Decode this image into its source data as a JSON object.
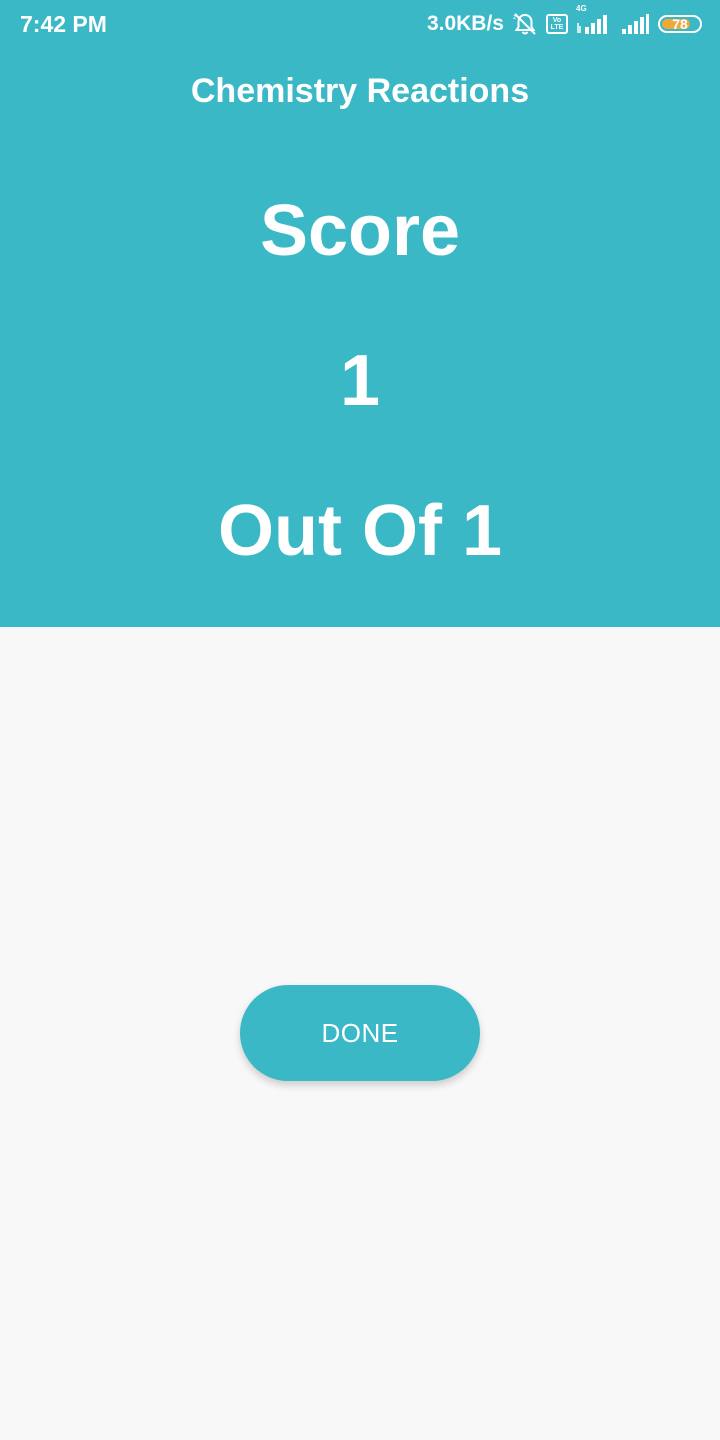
{
  "status_bar": {
    "time": "7:42 PM",
    "network_speed": "3.0KB/s",
    "volte_line1": "Vo",
    "volte_line2": "LTE",
    "network_type": "4G",
    "battery_percent": "78",
    "battery_level": 0.78,
    "icons": [
      "alarm-off-icon",
      "volte-icon",
      "signal-4g-icon",
      "signal-icon",
      "battery-icon"
    ]
  },
  "header": {
    "title": "Chemistry Reactions"
  },
  "result": {
    "score_label": "Score",
    "score_value": "1",
    "total_text": "Out Of 1"
  },
  "actions": {
    "done_label": "DONE"
  },
  "colors": {
    "accent": "#3bb8c6",
    "background": "#f8f8f8",
    "text_on_accent": "#ffffff",
    "battery_fill": "#f0a83a"
  }
}
